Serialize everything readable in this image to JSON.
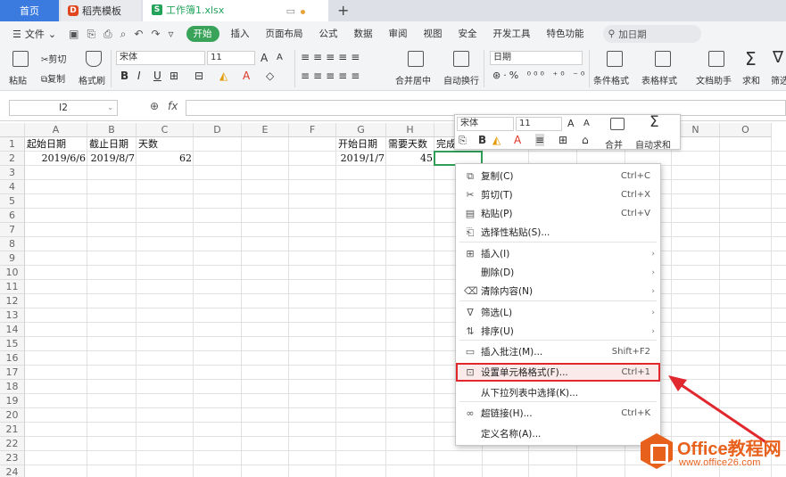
{
  "tabs": {
    "home": "首页",
    "template": "稻壳模板",
    "file": "工作簿1.xlsx"
  },
  "menu": {
    "file": "文件",
    "tabs": [
      "开始",
      "插入",
      "页面布局",
      "公式",
      "数据",
      "审阅",
      "视图",
      "安全",
      "开发工具",
      "特色功能"
    ],
    "search": "加日期"
  },
  "ribbon": {
    "paste": "粘贴",
    "cut": "剪切",
    "copy": "复制",
    "format_painter": "格式刷",
    "font_name": "宋体",
    "font_size": "11",
    "merge": "合并居中",
    "wrap": "自动换行",
    "number_format": "日期",
    "cond_format": "条件格式",
    "table_style": "表格样式",
    "doc_helper": "文档助手",
    "sum": "求和",
    "filter": "筛选"
  },
  "formula": {
    "name_box": "I2",
    "fx": "fx"
  },
  "sheet": {
    "columns": [
      "A",
      "B",
      "C",
      "D",
      "E",
      "F",
      "G",
      "H",
      "I",
      "J",
      "K",
      "L",
      "M",
      "N",
      "O"
    ],
    "row_count": 24,
    "cells": {
      "A1": "起始日期",
      "B1": "截止日期",
      "C1": "天数",
      "A2": "2019/6/6",
      "B2": "2019/8/7",
      "C2": "62",
      "G1": "开始日期",
      "H1": "需要天数",
      "I1": "完成",
      "G2": "2019/1/7",
      "H2": "45"
    }
  },
  "mini_toolbar": {
    "font": "宋体",
    "size": "11",
    "merge": "合并",
    "autosum": "自动求和"
  },
  "context_menu": [
    {
      "label": "复制(C)",
      "shortcut": "Ctrl+C",
      "icon": "copy-icon"
    },
    {
      "label": "剪切(T)",
      "shortcut": "Ctrl+X",
      "icon": "scissors-icon"
    },
    {
      "label": "粘贴(P)",
      "shortcut": "Ctrl+V",
      "icon": "paste-icon"
    },
    {
      "label": "选择性粘贴(S)...",
      "shortcut": "",
      "icon": "paste-special-icon"
    },
    {
      "label": "插入(I)",
      "shortcut": "",
      "icon": "insert-icon",
      "submenu": true
    },
    {
      "label": "删除(D)",
      "shortcut": "",
      "icon": "",
      "submenu": true
    },
    {
      "label": "清除内容(N)",
      "shortcut": "",
      "icon": "eraser-icon",
      "submenu": true
    },
    {
      "label": "筛选(L)",
      "shortcut": "",
      "icon": "filter-icon",
      "submenu": true
    },
    {
      "label": "排序(U)",
      "shortcut": "",
      "icon": "sort-icon",
      "submenu": true
    },
    {
      "label": "插入批注(M)...",
      "shortcut": "Shift+F2",
      "icon": "comment-icon"
    },
    {
      "label": "设置单元格格式(F)...",
      "shortcut": "Ctrl+1",
      "icon": "format-cells-icon",
      "highlight": true
    },
    {
      "label": "从下拉列表中选择(K)...",
      "shortcut": "",
      "icon": ""
    },
    {
      "label": "超链接(H)...",
      "shortcut": "Ctrl+K",
      "icon": "link-icon"
    },
    {
      "label": "定义名称(A)...",
      "shortcut": "",
      "icon": ""
    }
  ],
  "watermark": {
    "brand": "Office教程网",
    "url": "www.office26.com"
  },
  "colors": {
    "accent": "#3aa35a",
    "highlight": "#e0282e",
    "watermark": "#e8611c"
  }
}
